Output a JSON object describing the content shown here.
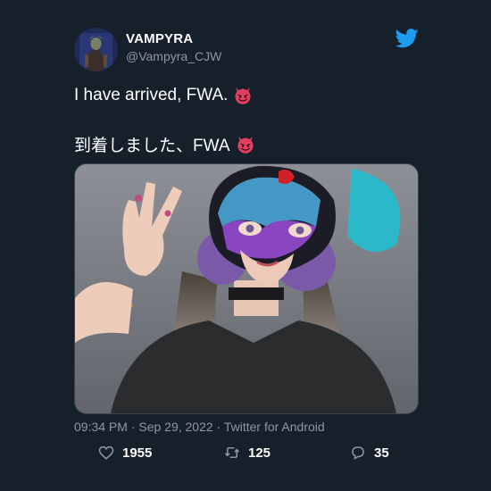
{
  "author": {
    "display_name": "VAMPYRA",
    "handle": "@Vampyra_CJW"
  },
  "tweet": {
    "line1": "I have arrived, FWA.",
    "line2": "到着しました、FWA",
    "emoji": "smiling-devil-emoji"
  },
  "meta": {
    "timestamp": "09:34 PM · Sep 29, 2022 · Twitter for Android"
  },
  "stats": {
    "likes": "1955",
    "retweets": "125",
    "replies": "35"
  },
  "icons": {
    "brand": "twitter-bird-icon",
    "like": "heart-icon",
    "retweet": "retweet-icon",
    "reply": "reply-bubble-icon"
  },
  "colors": {
    "background": "#15202b",
    "brand_blue": "#1d9bf0",
    "muted_text": "#8b98a5"
  }
}
